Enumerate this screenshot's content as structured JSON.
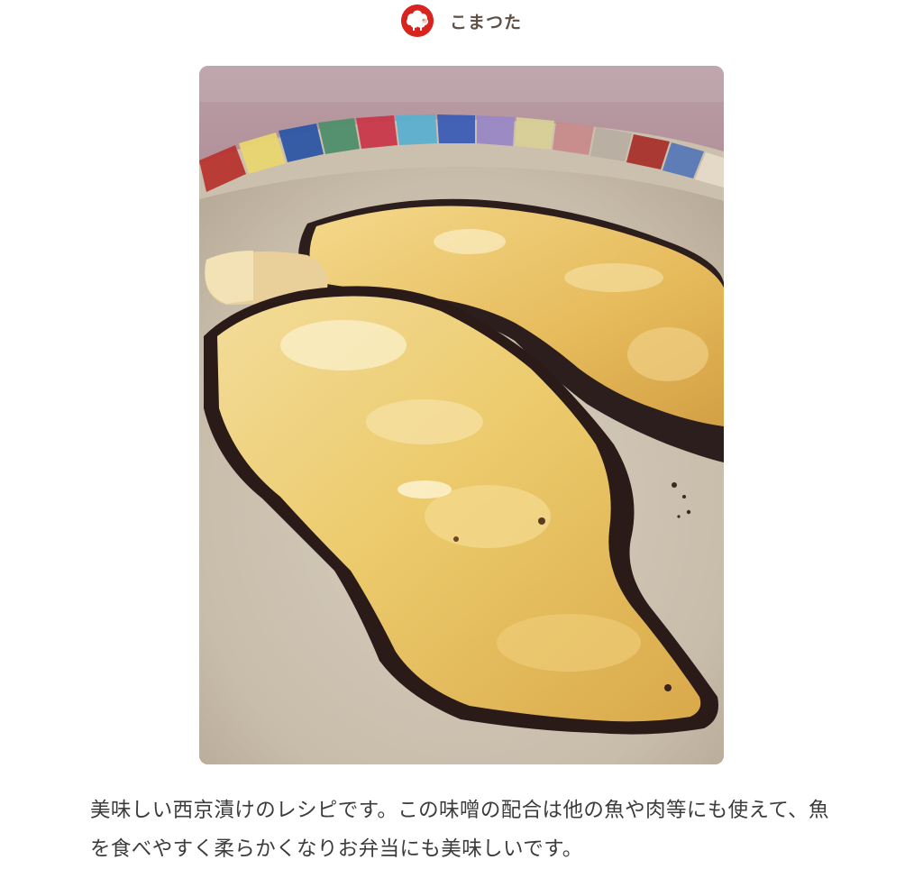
{
  "author": {
    "name": "こまつた",
    "avatar_icon": "sheep-avatar-icon"
  },
  "recipe": {
    "photo_subject": "saikyo-yaki-fish-photo",
    "description": "美味しい西京漬けのレシピです。この味噌の配合は他の魚や肉等にも使えて、魚を食べやすく柔らかくなりお弁当にも美味しいです。"
  },
  "colors": {
    "avatar_red": "#d7241f",
    "author_text": "#5e5046",
    "body_text": "#3c3c3c"
  }
}
